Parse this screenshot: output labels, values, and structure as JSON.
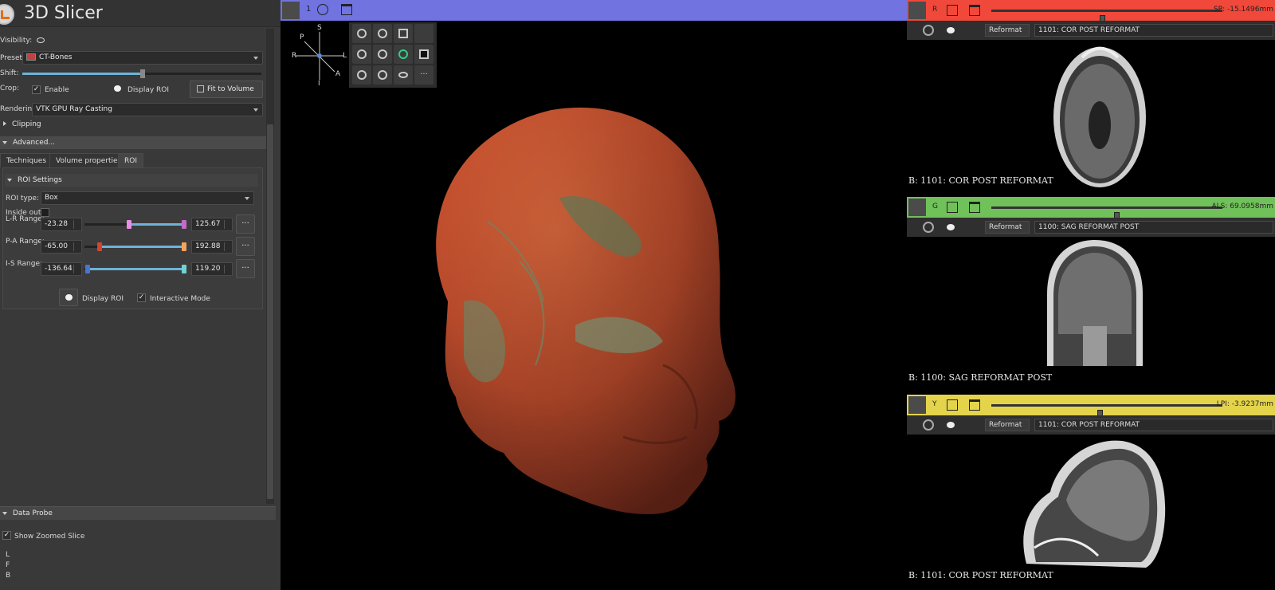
{
  "app": {
    "title": "3D Slicer"
  },
  "volume_rendering": {
    "visibility_label": "Visibility:",
    "preset_label": "Preset:",
    "preset_value": "CT-Bones",
    "shift_label": "Shift:",
    "crop_label": "Crop:",
    "enable_label": "Enable",
    "display_roi_label": "Display ROI",
    "fit_button": "Fit to Volume",
    "rendering_label": "Rendering:",
    "rendering_value": "VTK GPU Ray Casting",
    "clipping_label": "Clipping",
    "advanced_label": "Advanced...",
    "tabs": [
      "Techniques",
      "Volume properties",
      "ROI"
    ],
    "roi_settings_label": "ROI Settings",
    "roi_type_label": "ROI type:",
    "roi_type_value": "Box",
    "inside_out_label": "Inside out:",
    "ranges": [
      {
        "label": "L-R Range:",
        "min": "-23.28",
        "max": "125.67",
        "low_frac": 0.44,
        "high_frac": 0.98,
        "low_color": "#e98ee8",
        "high_color": "#c46ac7"
      },
      {
        "label": "P-A Range:",
        "min": "-65.00",
        "max": "192.88",
        "low_frac": 0.15,
        "high_frac": 0.98,
        "low_color": "#d2452c",
        "high_color": "#f3a35b"
      },
      {
        "label": "I-S Range:",
        "min": "-136.64",
        "max": "119.20",
        "low_frac": 0.03,
        "high_frac": 0.98,
        "low_color": "#4c73d1",
        "high_color": "#6fd2d6"
      }
    ],
    "display_roi_bottom": "Display ROI",
    "interactive_mode": "Interactive Mode"
  },
  "data_probe": {
    "label": "Data Probe",
    "show_zoomed_slice": "Show Zoomed Slice",
    "lines": [
      "L",
      "F",
      "B"
    ]
  },
  "view3d": {
    "label": "1",
    "bar_color": "#7173e0",
    "orientation": {
      "s": "S",
      "p": "P",
      "r": "R",
      "l": "L",
      "a": "A",
      "i": "I"
    }
  },
  "slices": [
    {
      "letter": "R",
      "color": "#f0483a",
      "offset": "SP: -15.1496mm",
      "reformat": "Reformat",
      "volume": "1101: COR POST REFORMAT",
      "caption": "B: 1101: COR POST REFORMAT",
      "slider_frac": 0.48
    },
    {
      "letter": "G",
      "color": "#70c159",
      "offset": "ALS: 69.0958mm",
      "reformat": "Reformat",
      "volume": "1100: SAG REFORMAT POST",
      "caption": "B: 1100: SAG REFORMAT POST",
      "slider_frac": 0.54
    },
    {
      "letter": "Y",
      "color": "#e4d44c",
      "offset": "LPI: -3.9237mm",
      "reformat": "Reformat",
      "volume": "1101: COR POST REFORMAT",
      "caption": "B: 1101: COR POST REFORMAT",
      "slider_frac": 0.47
    }
  ]
}
